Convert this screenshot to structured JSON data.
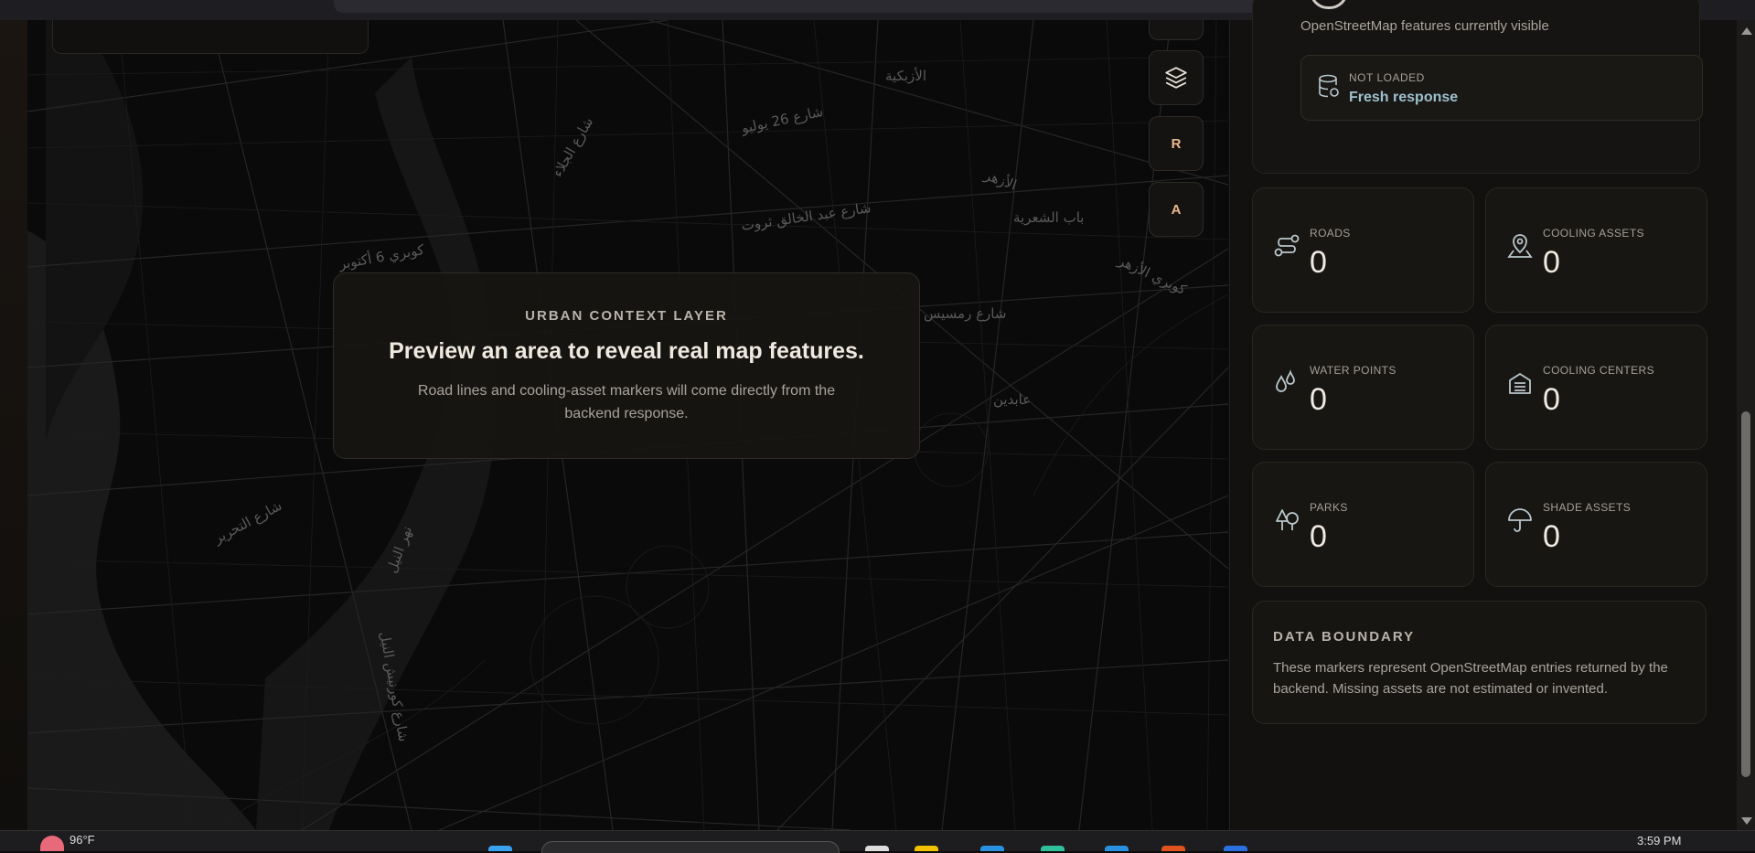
{
  "map": {
    "labels": [
      "الأزبكية",
      "شارع 26 يوليو",
      "كوبري 6 أكتوبر",
      "باب الشعرية",
      "الأزهر",
      "شارع عبد الخالق ثروت",
      "عابدين",
      "شارع التحرير",
      "نهر النيل",
      "شارع كورنيش النيل",
      "كوبري الأزهر",
      "شارع الجلاء",
      "شارع رمسيس"
    ],
    "controls": {
      "layers_icon": "layers-icon",
      "r_label": "R",
      "a_label": "A"
    },
    "overlay": {
      "kicker": "URBAN CONTEXT LAYER",
      "headline": "Preview an area to reveal real map features.",
      "description": "Road lines and cooling-asset markers will come directly from the backend response."
    }
  },
  "panel": {
    "visible_text": "OpenStreetMap features currently visible",
    "status": {
      "label": "NOT LOADED",
      "value": "Fresh response"
    },
    "stats": [
      {
        "label": "ROADS",
        "value": "0",
        "icon": "route-icon"
      },
      {
        "label": "COOLING ASSETS",
        "value": "0",
        "icon": "map-pin-icon"
      },
      {
        "label": "WATER POINTS",
        "value": "0",
        "icon": "droplets-icon"
      },
      {
        "label": "COOLING CENTERS",
        "value": "0",
        "icon": "building-icon"
      },
      {
        "label": "PARKS",
        "value": "0",
        "icon": "trees-icon"
      },
      {
        "label": "SHADE ASSETS",
        "value": "0",
        "icon": "umbrella-icon"
      }
    ],
    "boundary": {
      "title": "DATA BOUNDARY",
      "text": "These markers represent OpenStreetMap entries returned by the backend. Missing assets are not estimated or invented."
    }
  },
  "taskbar": {
    "weather": "96°F",
    "time": "3:59 PM"
  },
  "colors": {
    "accent_link": "#9ec1cf",
    "control_text": "#e8b88e",
    "background": "#0d0c0b"
  }
}
